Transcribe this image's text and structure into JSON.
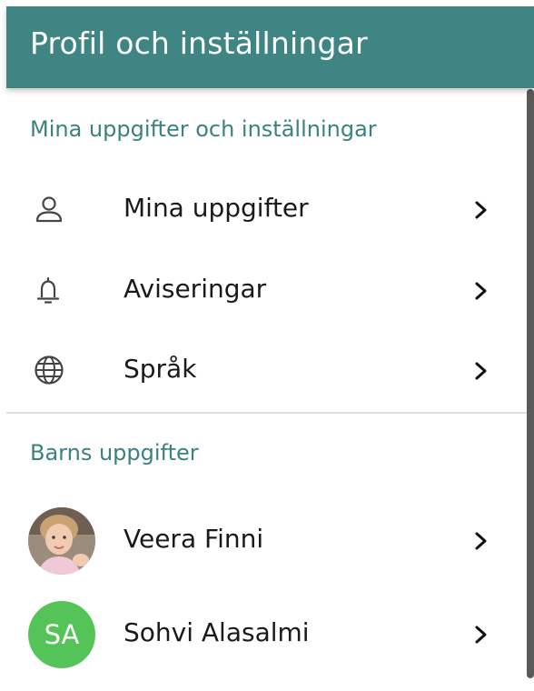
{
  "header": {
    "title": "Profil och inställningar"
  },
  "settings_section": {
    "title": "Mina uppgifter och inställningar",
    "items": [
      {
        "label": "Mina uppgifter",
        "icon": "person-icon"
      },
      {
        "label": "Aviseringar",
        "icon": "bell-icon"
      },
      {
        "label": "Språk",
        "icon": "globe-icon"
      }
    ]
  },
  "children_section": {
    "title": "Barns uppgifter",
    "items": [
      {
        "label": "Veera Finni",
        "avatar": "photo"
      },
      {
        "label": "Sohvi Alasalmi",
        "initials": "SA",
        "avatar_color": "#55c458"
      }
    ]
  },
  "colors": {
    "header_bg": "#3e8584",
    "accent_text": "#3a8280"
  }
}
